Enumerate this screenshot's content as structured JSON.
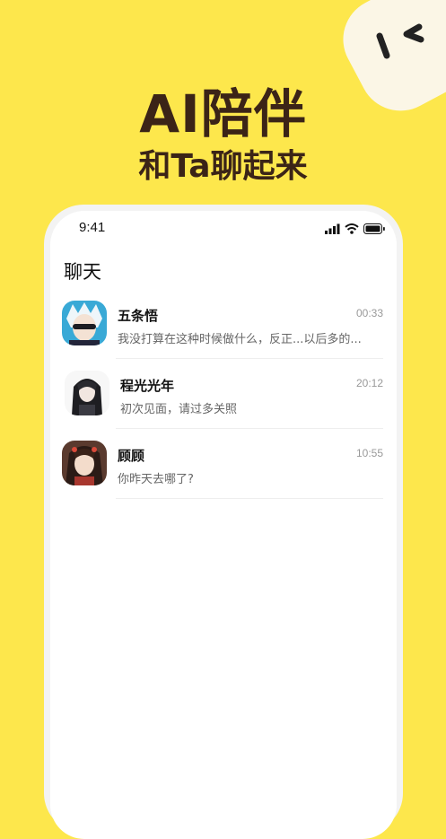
{
  "promo": {
    "headline": "AI陪伴",
    "subheadline": "和Ta聊起来"
  },
  "status_bar": {
    "time": "9:41",
    "icons": [
      "signal-icon",
      "wifi-icon",
      "battery-icon"
    ]
  },
  "page": {
    "title": "聊天"
  },
  "chats": [
    {
      "name": "五条悟",
      "time": "00:33",
      "preview": "我没打算在这种时候做什么，反正...以后多的..."
    },
    {
      "name": "程光光年",
      "time": "20:12",
      "preview": "初次见面，请过多关照"
    },
    {
      "name": "顾顾",
      "time": "10:55",
      "preview": "你昨天去哪了?"
    }
  ],
  "colors": {
    "background": "#FDE74C",
    "headline": "#3B2417",
    "screen": "#FFFFFF"
  }
}
